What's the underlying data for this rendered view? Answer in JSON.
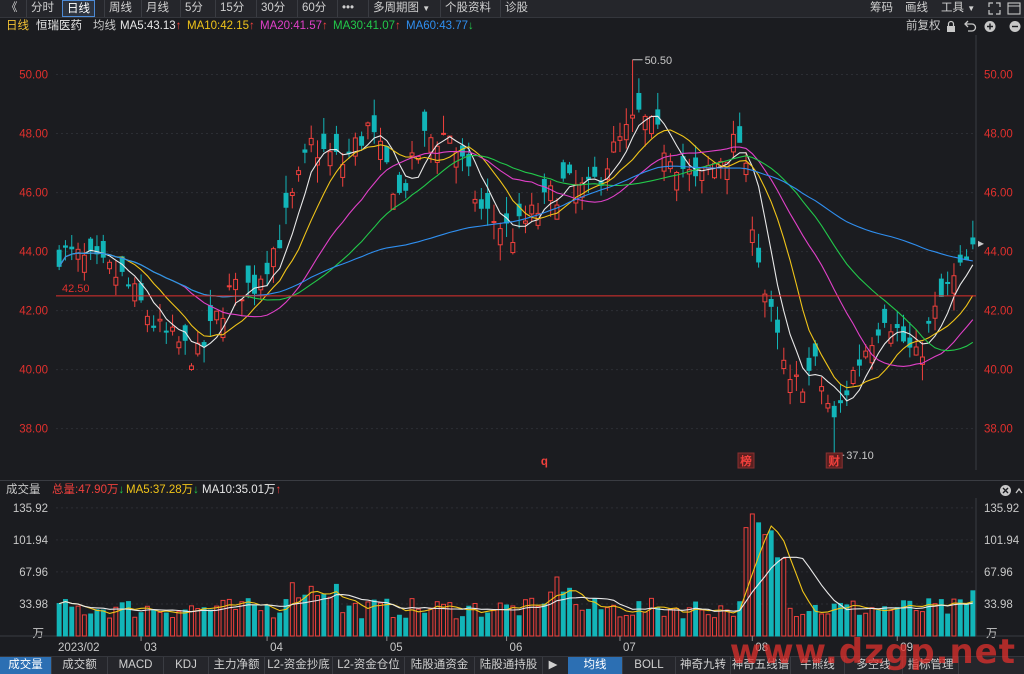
{
  "toolbar": {
    "back_glyph": "《",
    "periods": [
      "分时",
      "日线",
      "周线",
      "月线",
      "5分",
      "15分",
      "30分",
      "60分"
    ],
    "active_period": "日线",
    "more_glyph": "•••",
    "multi_period": "多周期图",
    "stock_info": "个股资料",
    "diagnose": "诊股",
    "right": [
      "筹码",
      "画线",
      "工具"
    ],
    "dropdown_glyph": "▼",
    "right_icons": [
      "restore-icon",
      "minimize-icon",
      "maximize-icon",
      "close-icon"
    ]
  },
  "indicator_bar": {
    "period_label": "日线",
    "stock_name": "恒瑞医药",
    "ma_label": "均线",
    "mas": [
      {
        "text": "MA5:43.13",
        "arrow": "↑",
        "color": "#e8e8e8"
      },
      {
        "text": "MA10:42.15",
        "arrow": "↑",
        "color": "#f0c419"
      },
      {
        "text": "MA20:41.57",
        "arrow": "↑",
        "color": "#e040c8"
      },
      {
        "text": "MA30:41.07",
        "arrow": "↑",
        "color": "#22c84a"
      },
      {
        "text": "MA60:43.77",
        "arrow": "↓",
        "color": "#2f8ff0"
      }
    ],
    "adjust_mode": "前复权"
  },
  "volume_bar": {
    "title": "成交量",
    "total": "总量:47.90万",
    "total_arrow": "↓",
    "ma5": "MA5:37.28万",
    "ma5_arrow": "↓",
    "ma10": "MA10:35.01万",
    "ma10_arrow": "↑"
  },
  "bottom_tabs": [
    "成交量",
    "成交额",
    "MACD",
    "KDJ",
    "主力净额",
    "L2-资金抄底",
    "L2-资金仓位",
    "陆股通资金",
    "陆股通持股"
  ],
  "bottom_tabs_right": [
    "均线",
    "BOLL",
    "神奇九转",
    "神奇五线谱",
    "牛熊线",
    "多空线",
    "指标管理"
  ],
  "selected_bottom_tab": "成交量",
  "selected_bottom_tab_right": "均线",
  "tabs_arrow": "▶",
  "watermark": "www.dzgp.net",
  "colors": {
    "up": "#f0403c",
    "down": "#12b5b8",
    "ma5": "#e8e8e8",
    "ma10": "#f0c419",
    "ma20": "#e040c8",
    "ma30": "#22c84a",
    "ma60": "#2f8ff0",
    "grid": "#2c2e34",
    "hline": "#e0302d",
    "price_axis_text": "#e0302d",
    "background": "#1b1c20"
  },
  "chart_data": [
    {
      "type": "candlestick",
      "stock": "恒瑞医药",
      "period": "日线",
      "y_ticks": [
        38.0,
        40.0,
        42.0,
        44.0,
        46.0,
        48.0,
        50.0
      ],
      "y_tick_labels": [
        "38.00",
        "40.00",
        "42.00",
        "44.00",
        "46.00",
        "48.00",
        "50.00"
      ],
      "ylim": [
        36.6,
        51.0
      ],
      "x_ticks": [
        "03",
        "04",
        "05",
        "06",
        "07",
        "08",
        "09"
      ],
      "x_tick_positions": [
        13,
        33,
        52,
        71,
        89,
        110,
        133
      ],
      "first_date_label": "2023/02",
      "n_bars": 146,
      "price_line": {
        "value": 42.5,
        "label": "42.50"
      },
      "annotations": [
        {
          "text": "50.50",
          "value": 50.5,
          "bar": 91,
          "kind": "high"
        },
        {
          "text": "37.10",
          "value": 37.1,
          "bar": 123,
          "kind": "low"
        }
      ],
      "markers": [
        {
          "text": "q",
          "bar": 77
        },
        {
          "text": "榜",
          "bar": 109
        },
        {
          "text": "财",
          "bar": 123
        }
      ],
      "bars": [],
      "ma_last": {
        "MA5": 43.13,
        "MA10": 42.15,
        "MA20": 41.57,
        "MA30": 41.07,
        "MA60": 43.77
      },
      "grid": true
    },
    {
      "type": "bar",
      "title": "成交量",
      "unit": "万",
      "y_ticks": [
        33.98,
        67.96,
        101.94,
        135.92
      ],
      "ylim": [
        0,
        140
      ],
      "last_volume": 47.9,
      "ma_last": {
        "MA5": 37.28,
        "MA10": 35.01
      }
    }
  ]
}
